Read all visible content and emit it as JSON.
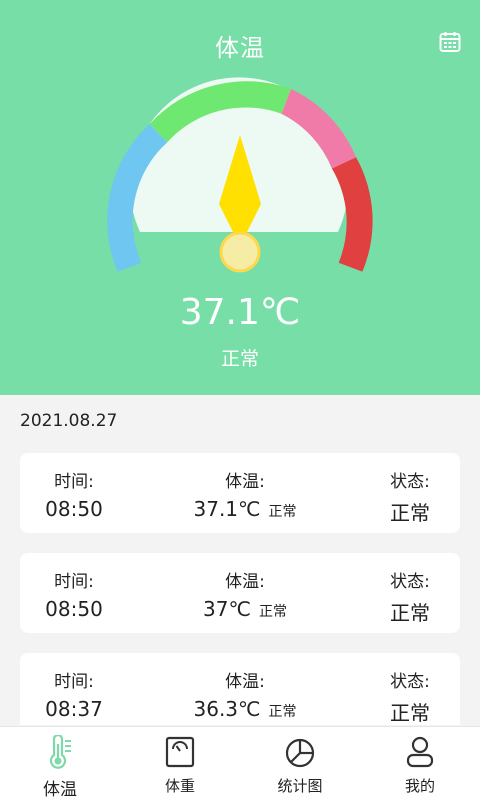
{
  "header": {
    "title": "体温",
    "calendar_icon": "calendar-icon"
  },
  "gauge": {
    "value": "37.1℃",
    "status": "正常",
    "colors": {
      "blue": "#6fc6f0",
      "green": "#6ee870",
      "pink": "#f07aa8",
      "red": "#e04040",
      "needle": "#ffe000"
    }
  },
  "date": "2021.08.27",
  "records": [
    {
      "time_label": "时间:",
      "time": "08:50",
      "temp_label": "体温:",
      "temp": "37.1℃",
      "temp_status": "正常",
      "state_label": "状态:",
      "state": "正常"
    },
    {
      "time_label": "时间:",
      "time": "08:50",
      "temp_label": "体温:",
      "temp": "37℃",
      "temp_status": "正常",
      "state_label": "状态:",
      "state": "正常"
    },
    {
      "time_label": "时间:",
      "time": "08:37",
      "temp_label": "体温:",
      "temp": "36.3℃",
      "temp_status": "正常",
      "state_label": "状态:",
      "state": "正常"
    }
  ],
  "tabs": [
    {
      "label": "体温",
      "icon": "thermometer-icon",
      "active": true
    },
    {
      "label": "体重",
      "icon": "scale-icon",
      "active": false
    },
    {
      "label": "统计图",
      "icon": "pie-chart-icon",
      "active": false
    },
    {
      "label": "我的",
      "icon": "user-icon",
      "active": false
    }
  ],
  "colors": {
    "accent": "#76dea6",
    "active_tab": "#7ed8a8"
  }
}
